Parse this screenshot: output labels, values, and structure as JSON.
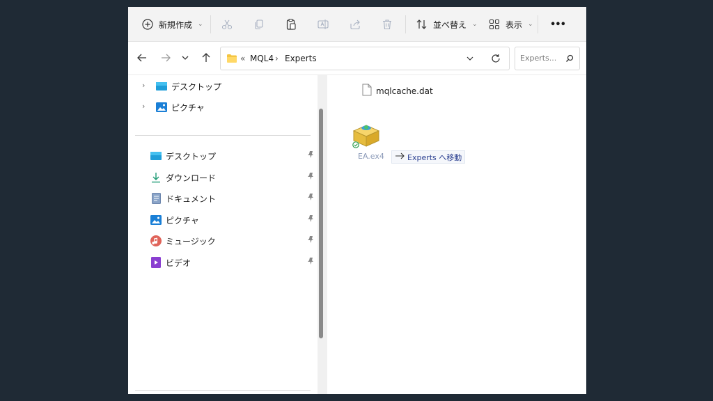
{
  "toolbar": {
    "new_label": "新規作成",
    "sort_label": "並べ替え",
    "view_label": "表示",
    "more_label": "•••"
  },
  "address": {
    "overflow": "«",
    "crumbs": [
      "MQL4",
      "Experts"
    ],
    "search_placeholder": "Experts..."
  },
  "sidebar": {
    "top_items": [
      {
        "label": "デスクトップ",
        "icon": "desktop-icon"
      },
      {
        "label": "ピクチャ",
        "icon": "pictures-icon"
      }
    ],
    "quick_access": [
      {
        "label": "デスクトップ",
        "icon": "desktop-icon"
      },
      {
        "label": "ダウンロード",
        "icon": "download-icon"
      },
      {
        "label": "ドキュメント",
        "icon": "documents-icon"
      },
      {
        "label": "ピクチャ",
        "icon": "pictures-icon"
      },
      {
        "label": "ミュージック",
        "icon": "music-icon"
      },
      {
        "label": "ビデオ",
        "icon": "video-icon"
      }
    ]
  },
  "content": {
    "file_name": "mqlcache.dat",
    "dragged_name": "EA.ex4",
    "move_tooltip": "Experts へ移動"
  },
  "colors": {
    "background": "#1f2a35",
    "toolbar": "#f3f3f3",
    "folder": "#f4c542",
    "tooltip_text": "#2a3f90"
  }
}
